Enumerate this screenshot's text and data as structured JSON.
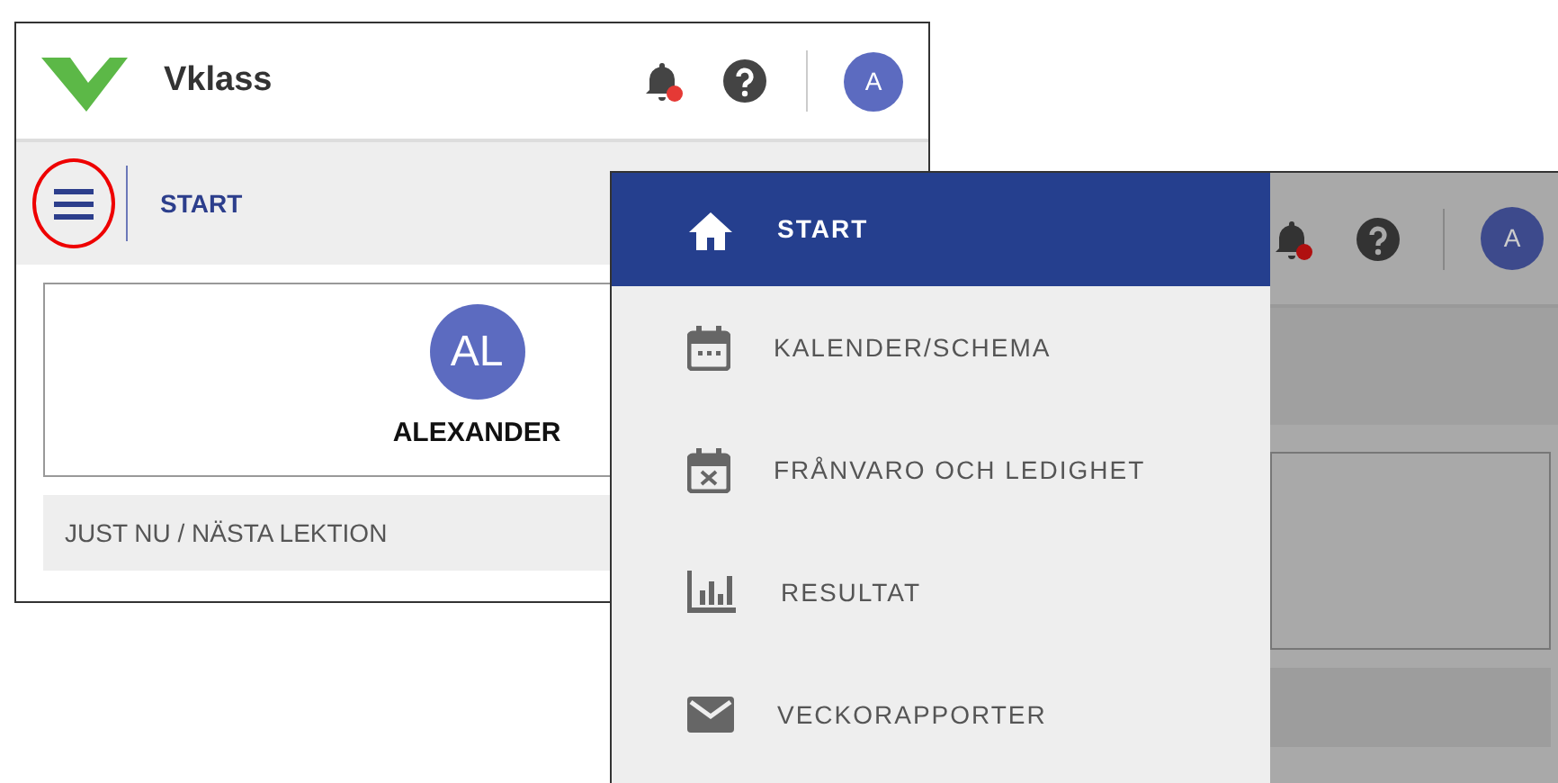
{
  "back_window": {
    "app_name": "Vklass",
    "notification_unread": true,
    "avatar": "A",
    "menu_button_highlighted": true,
    "breadcrumb": "START",
    "profile": {
      "initials": "AL",
      "name": "ALEXANDER"
    },
    "section_title": "JUST NU / NÄSTA LEKTION"
  },
  "front_window": {
    "notification_unread": true,
    "avatar": "A",
    "menu_items": [
      {
        "label": "START",
        "kind": "home",
        "selected": true
      },
      {
        "label": "KALENDER/SCHEMA",
        "kind": "calendar",
        "selected": false
      },
      {
        "label": "FRÅNVARO OCH LEDIGHET",
        "kind": "absence",
        "selected": false
      },
      {
        "label": "RESULTAT",
        "kind": "results",
        "selected": false
      },
      {
        "label": "VECKORAPPORTER",
        "kind": "reports",
        "selected": false
      }
    ]
  }
}
